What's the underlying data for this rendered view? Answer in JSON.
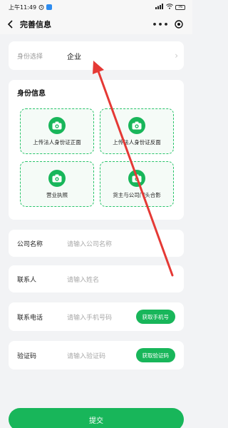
{
  "status_bar": {
    "time": "上午11:49",
    "battery": "76"
  },
  "nav": {
    "title": "完善信息",
    "more": "•••"
  },
  "identity": {
    "label": "身份选择",
    "value": "企业"
  },
  "id_info": {
    "title": "身份信息",
    "tiles": [
      {
        "label": "上传法人身份证正面"
      },
      {
        "label": "上传法人身份证反面"
      },
      {
        "label": "营业执照"
      },
      {
        "label": "货主与公司门头合影"
      }
    ]
  },
  "company": {
    "label": "公司名称",
    "placeholder": "请输入公司名称"
  },
  "contact": {
    "label": "联系人",
    "placeholder": "请输入姓名"
  },
  "phone": {
    "label": "联系电话",
    "placeholder": "请输入手机号码",
    "button": "获取手机号"
  },
  "code": {
    "label": "验证码",
    "placeholder": "请输入验证码",
    "button": "获取验证码"
  },
  "submit": {
    "label": "提交"
  },
  "colors": {
    "accent": "#18b65a",
    "arrow": "#e53935"
  }
}
